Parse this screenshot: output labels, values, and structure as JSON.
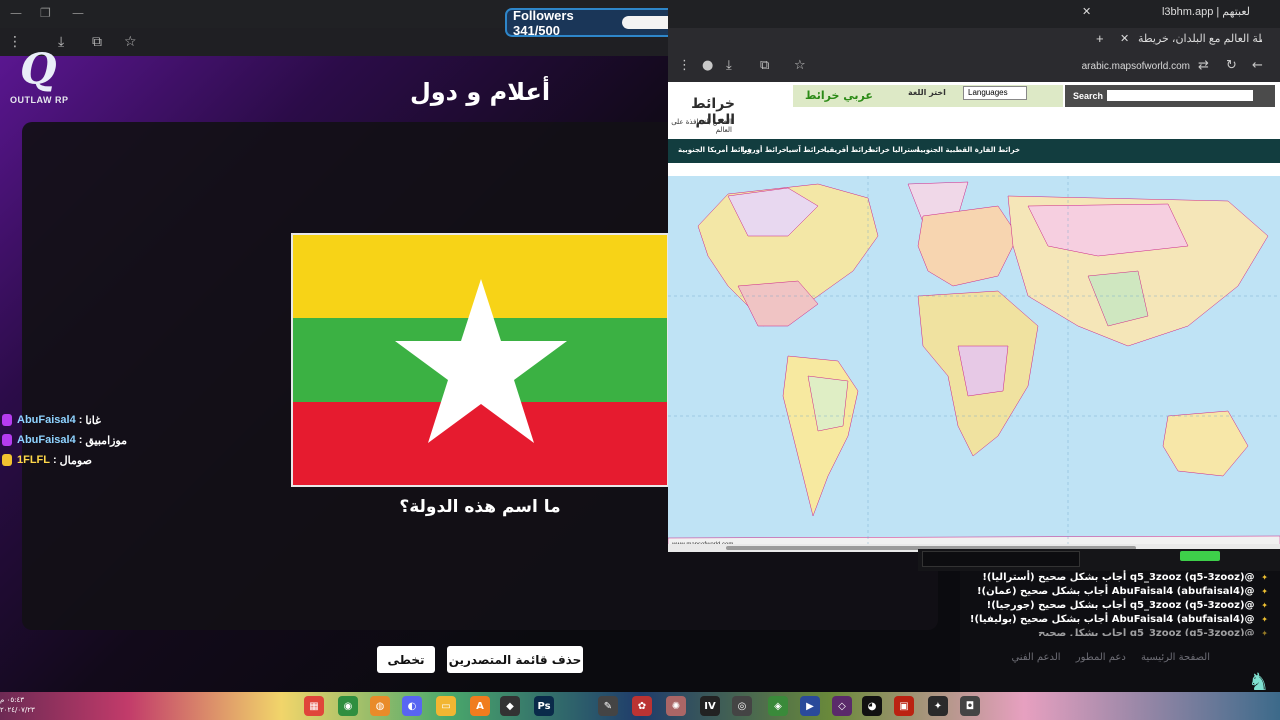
{
  "followers": {
    "label": "Followers 341/500",
    "current": 341,
    "goal": 500
  },
  "browser_right": {
    "tab1": "l3bhm.app | لعبتهم",
    "tab2": "خريطة العالم مع البلدان، خريطة",
    "url": "arabic.mapsofworld.com"
  },
  "game": {
    "logo_text": "OUTLAW RP",
    "title": "أعلام و دول",
    "question": "ما اسم هذه الدولة؟",
    "skip": "تخطى",
    "clear_leaderboard": "حذف قائمة المتصدرين",
    "flag_colors": {
      "top": "#f7d317",
      "middle": "#3bb143",
      "bottom": "#e61b2f",
      "star": "#ffffff"
    }
  },
  "answers": [
    {
      "user": "AbuFaisal4",
      "country": "غانا",
      "icon": "microphone-icon",
      "color": "#8fd3ff"
    },
    {
      "user": "AbuFaisal4",
      "country": "موزامبيق",
      "icon": "microphone-icon",
      "color": "#8fd3ff"
    },
    {
      "user": "1FLFL",
      "country": "صومال",
      "icon": "crown-icon",
      "color": "#ffd84a"
    }
  ],
  "site": {
    "logo": "خرائط العالم",
    "tagline": "الخاص بك نافذة على العالم",
    "green_banner": "عربي خرائط",
    "language_label": "اختر اللغة",
    "language_select": "Languages",
    "search_label": "Search",
    "menu": [
      "خرائط القارة القطبية الجنوبية",
      "استراليا خرائط",
      "خرائط أفريقيا",
      "خرائط آسيا",
      "خرائط أوروبا",
      "خرائط أمريكا الجنوبية"
    ],
    "map_footer": "www.mapsofworld.com"
  },
  "feed": [
    "@q5_3zooz (q5-3zooz) أجاب بشكل صحيح (أستراليا)!",
    "@AbuFaisal4 (abufaisal4) أجاب بشكل صحيح (عمان)!",
    "@q5_3zooz (q5-3zooz) أجاب بشكل صحيح (جورجيا)!",
    "@AbuFaisal4 (abufaisal4) أجاب بشكل صحيح (بوليفيا)!",
    "@q5_3zooz (q5-3zooz) أجاب بشكل صحيح"
  ],
  "footer_links": [
    "الصفحة الرئيسية",
    "دعم المطور",
    "الدعم الفني"
  ],
  "taskbar": {
    "time": "٠٥:٤٣ م",
    "date": "٢٠٢٤/٠٧/٢٣"
  }
}
